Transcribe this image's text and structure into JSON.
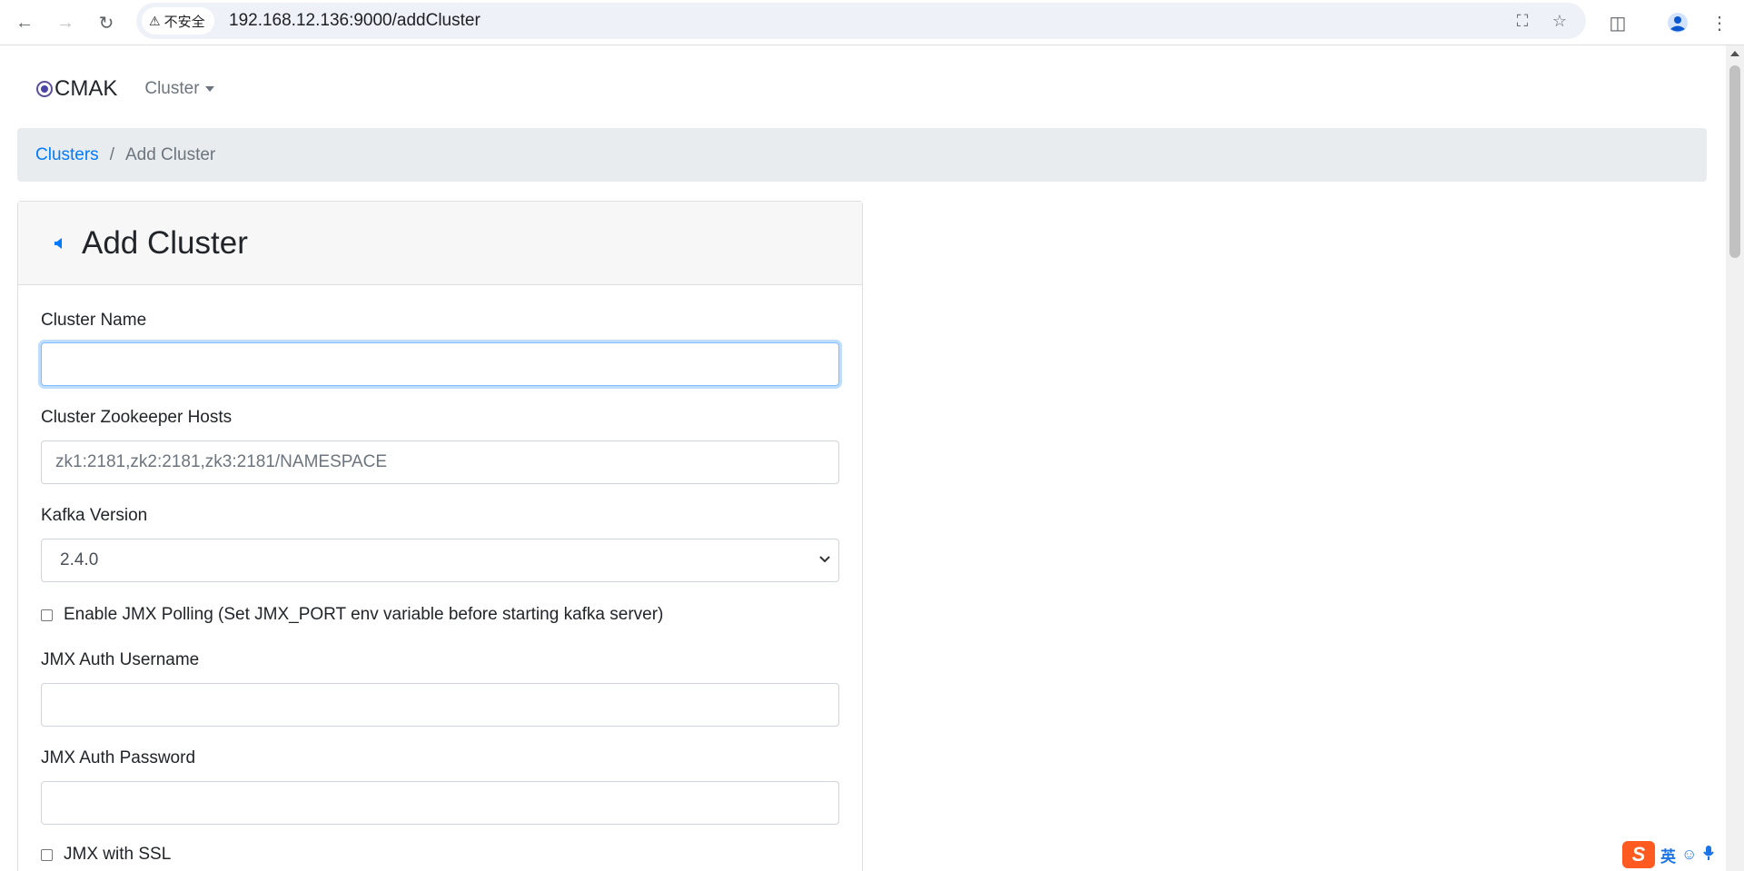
{
  "browser": {
    "security_label": "不安全",
    "url": "192.168.12.136:9000/addCluster"
  },
  "navbar": {
    "brand": "CMAK",
    "cluster_menu": "Cluster"
  },
  "breadcrumb": {
    "items": [
      {
        "label": "Clusters"
      },
      {
        "label": "Add Cluster"
      }
    ],
    "separator": "/"
  },
  "form": {
    "title": "Add Cluster",
    "cluster_name": {
      "label": "Cluster Name",
      "value": "",
      "placeholder": ""
    },
    "zookeeper_hosts": {
      "label": "Cluster Zookeeper Hosts",
      "value": "",
      "placeholder": "zk1:2181,zk2:2181,zk3:2181/NAMESPACE"
    },
    "kafka_version": {
      "label": "Kafka Version",
      "selected": "2.4.0"
    },
    "jmx_polling": {
      "label": "Enable JMX Polling (Set JMX_PORT env variable before starting kafka server)",
      "checked": false
    },
    "jmx_username": {
      "label": "JMX Auth Username",
      "value": ""
    },
    "jmx_password": {
      "label": "JMX Auth Password",
      "value": ""
    },
    "jmx_ssl": {
      "label": "JMX with SSL",
      "checked": false
    }
  },
  "ime": {
    "mode": "英"
  },
  "colors": {
    "link": "#007bff",
    "breadcrumb_bg": "#e9ecef",
    "focus_border": "#80bdff"
  }
}
